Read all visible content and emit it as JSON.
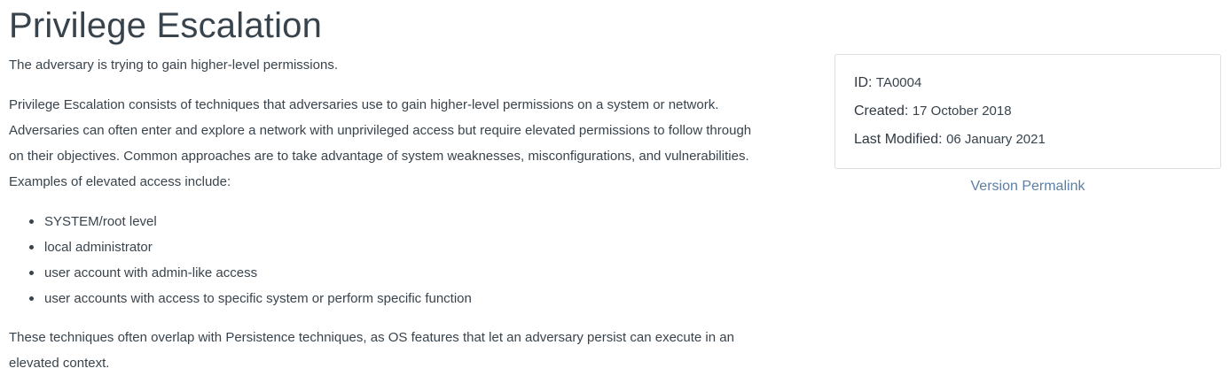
{
  "page": {
    "title": "Privilege Escalation",
    "tagline": "The adversary is trying to gain higher-level permissions.",
    "intro_lines": [
      "Privilege Escalation consists of techniques that adversaries use to gain higher-level permissions on a system or network.",
      "Adversaries can often enter and explore a network with unprivileged access but require elevated permissions to follow through",
      "on their objectives. Common approaches are to take advantage of system weaknesses, misconfigurations, and vulnerabilities.",
      "Examples of elevated access include:"
    ],
    "access_examples": [
      "SYSTEM/root level",
      "local administrator",
      "user account with admin-like access",
      "user accounts with access to specific system or perform specific function"
    ],
    "closing_lines": [
      "These techniques often overlap with Persistence techniques, as OS features that let an adversary persist can execute in an",
      "elevated context."
    ]
  },
  "card": {
    "id_label": "ID:",
    "id_value": "TA0004",
    "created_label": "Created:",
    "created_value": "17 October 2018",
    "modified_label": "Last Modified:",
    "modified_value": "06 January 2021",
    "permalink_label": "Version Permalink"
  },
  "colors": {
    "text": "#39434c",
    "link": "#5b7fa6",
    "card_border": "#dcdfe3"
  }
}
